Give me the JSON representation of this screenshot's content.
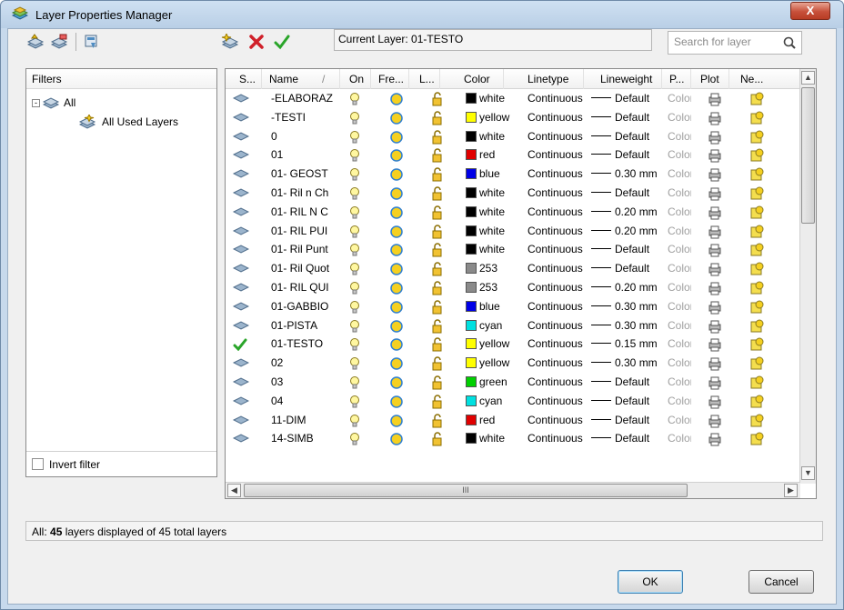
{
  "window": {
    "title": "Layer Properties Manager",
    "close_label": "X"
  },
  "toolbar": {
    "left_icons": [
      "new-property-filter-icon",
      "new-group-filter-icon",
      "layer-states-manager-icon"
    ],
    "mid_icons": [
      "new-layer-icon",
      "delete-layer-icon",
      "set-current-icon"
    ],
    "current_layer": "Current Layer: 01-TESTO",
    "search_placeholder": "Search for layer"
  },
  "filters": {
    "header": "Filters",
    "tree": [
      {
        "label": "All",
        "level": 0
      },
      {
        "label": "All Used Layers",
        "level": 1
      }
    ],
    "invert_label": "Invert filter"
  },
  "grid": {
    "columns": [
      "S...",
      "Name",
      "On",
      "Fre...",
      "L...",
      "Color",
      "Linetype",
      "Lineweight",
      "P...",
      "Plot",
      "Ne..."
    ],
    "sort_indicator": "/",
    "rows": [
      {
        "status": "layer",
        "name": "-ELABORAZ",
        "color": "white",
        "color_hex": "#000000",
        "linetype": "Continuous",
        "lineweight": "Default",
        "plot_style": "Color"
      },
      {
        "status": "layer",
        "name": "-TESTI",
        "color": "yellow",
        "color_hex": "#ffff00",
        "linetype": "Continuous",
        "lineweight": "Default",
        "plot_style": "Color"
      },
      {
        "status": "layer",
        "name": "0",
        "color": "white",
        "color_hex": "#000000",
        "linetype": "Continuous",
        "lineweight": "Default",
        "plot_style": "Color"
      },
      {
        "status": "layer",
        "name": "01",
        "color": "red",
        "color_hex": "#e00000",
        "linetype": "Continuous",
        "lineweight": "Default",
        "plot_style": "Color"
      },
      {
        "status": "layer",
        "name": "01- GEOST",
        "color": "blue",
        "color_hex": "#0000e6",
        "linetype": "Continuous",
        "lineweight": "0.30 mm",
        "plot_style": "Color"
      },
      {
        "status": "layer",
        "name": "01- Ril n Ch",
        "color": "white",
        "color_hex": "#000000",
        "linetype": "Continuous",
        "lineweight": "Default",
        "plot_style": "Color"
      },
      {
        "status": "layer",
        "name": "01- RIL N C",
        "color": "white",
        "color_hex": "#000000",
        "linetype": "Continuous",
        "lineweight": "0.20 mm",
        "plot_style": "Color"
      },
      {
        "status": "layer",
        "name": "01- RIL PUI",
        "color": "white",
        "color_hex": "#000000",
        "linetype": "Continuous",
        "lineweight": "0.20 mm",
        "plot_style": "Color"
      },
      {
        "status": "layer",
        "name": "01- Ril Punt",
        "color": "white",
        "color_hex": "#000000",
        "linetype": "Continuous",
        "lineweight": "Default",
        "plot_style": "Color"
      },
      {
        "status": "layer",
        "name": "01- Ril Quot",
        "color": "253",
        "color_hex": "#8a8a8a",
        "linetype": "Continuous",
        "lineweight": "Default",
        "plot_style": "Color"
      },
      {
        "status": "layer",
        "name": "01- RIL QUI",
        "color": "253",
        "color_hex": "#8a8a8a",
        "linetype": "Continuous",
        "lineweight": "0.20 mm",
        "plot_style": "Color"
      },
      {
        "status": "layer",
        "name": "01-GABBIO",
        "color": "blue",
        "color_hex": "#0000e6",
        "linetype": "Continuous",
        "lineweight": "0.30 mm",
        "plot_style": "Color"
      },
      {
        "status": "layer",
        "name": "01-PISTA",
        "color": "cyan",
        "color_hex": "#00e0e0",
        "linetype": "Continuous",
        "lineweight": "0.30 mm",
        "plot_style": "Color"
      },
      {
        "status": "current",
        "name": "01-TESTO",
        "color": "yellow",
        "color_hex": "#ffff00",
        "linetype": "Continuous",
        "lineweight": "0.15 mm",
        "plot_style": "Color"
      },
      {
        "status": "layer",
        "name": "02",
        "color": "yellow",
        "color_hex": "#ffff00",
        "linetype": "Continuous",
        "lineweight": "0.30 mm",
        "plot_style": "Color"
      },
      {
        "status": "layer",
        "name": "03",
        "color": "green",
        "color_hex": "#00d000",
        "linetype": "Continuous",
        "lineweight": "Default",
        "plot_style": "Color"
      },
      {
        "status": "layer",
        "name": "04",
        "color": "cyan",
        "color_hex": "#00e0e0",
        "linetype": "Continuous",
        "lineweight": "Default",
        "plot_style": "Color"
      },
      {
        "status": "layer",
        "name": "11-DIM",
        "color": "red",
        "color_hex": "#e00000",
        "linetype": "Continuous",
        "lineweight": "Default",
        "plot_style": "Color"
      },
      {
        "status": "layer",
        "name": "14-SIMB",
        "color": "white",
        "color_hex": "#000000",
        "linetype": "Continuous",
        "lineweight": "Default",
        "plot_style": "Color"
      }
    ],
    "hscroll_grip": "III"
  },
  "status_bar": {
    "prefix": "All:",
    "count": "45",
    "text": "layers displayed of 45 total layers"
  },
  "buttons": {
    "ok": "OK",
    "cancel": "Cancel"
  },
  "colors": {
    "accent": "#3c7fb1",
    "title_bg": "#c7d9ec",
    "current_check": "#2aa52a",
    "delete_red": "#d0202a"
  }
}
